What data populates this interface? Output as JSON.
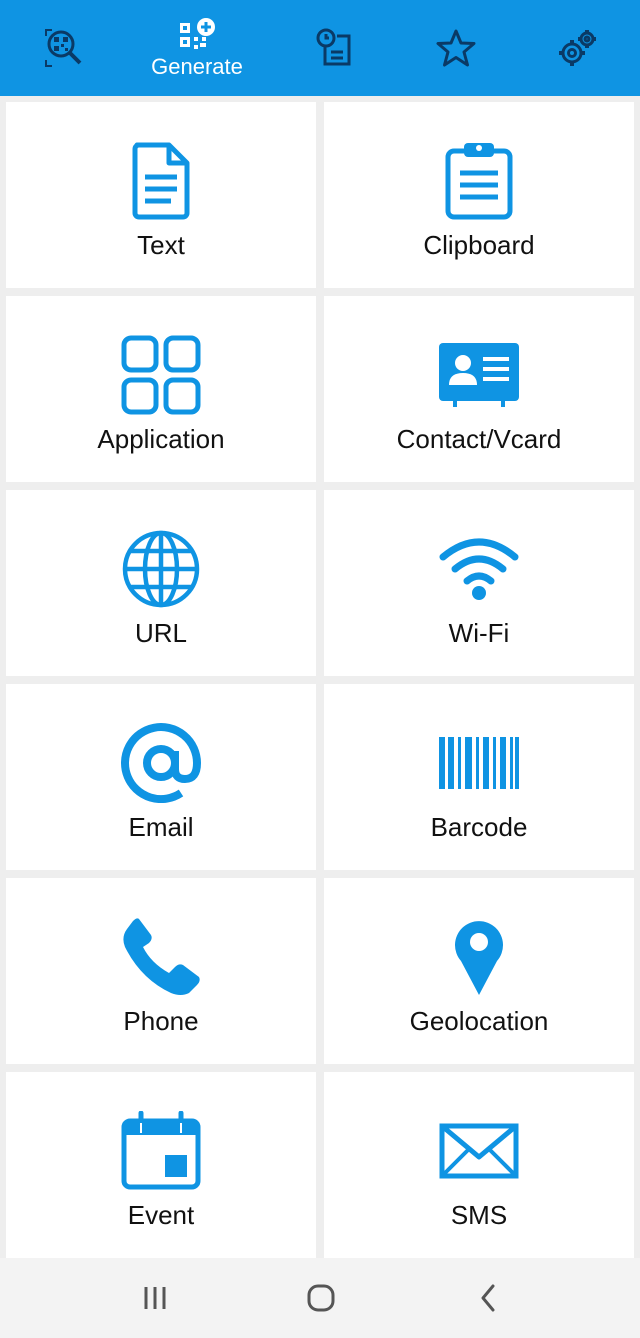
{
  "colors": {
    "accent": "#0f94e3",
    "background": "#eeeeee",
    "card": "#ffffff",
    "text": "#111111"
  },
  "top_tabs": [
    {
      "icon": "qr-scan-search-icon",
      "label": ""
    },
    {
      "icon": "qr-generate-icon",
      "label": "Generate",
      "active": true
    },
    {
      "icon": "history-icon",
      "label": ""
    },
    {
      "icon": "star-icon",
      "label": ""
    },
    {
      "icon": "settings-gear-icon",
      "label": ""
    }
  ],
  "items": [
    {
      "label": "Text",
      "icon": "document-icon"
    },
    {
      "label": "Clipboard",
      "icon": "clipboard-icon"
    },
    {
      "label": "Application",
      "icon": "apps-grid-icon"
    },
    {
      "label": "Contact/Vcard",
      "icon": "contact-card-icon"
    },
    {
      "label": "URL",
      "icon": "globe-icon"
    },
    {
      "label": "Wi-Fi",
      "icon": "wifi-icon"
    },
    {
      "label": "Email",
      "icon": "at-sign-icon"
    },
    {
      "label": "Barcode",
      "icon": "barcode-icon"
    },
    {
      "label": "Phone",
      "icon": "phone-icon"
    },
    {
      "label": "Geolocation",
      "icon": "map-pin-icon"
    },
    {
      "label": "Event",
      "icon": "calendar-icon"
    },
    {
      "label": "SMS",
      "icon": "envelope-icon"
    }
  ],
  "nav_bar": [
    {
      "icon": "recent-apps-icon"
    },
    {
      "icon": "home-icon"
    },
    {
      "icon": "back-icon"
    }
  ]
}
